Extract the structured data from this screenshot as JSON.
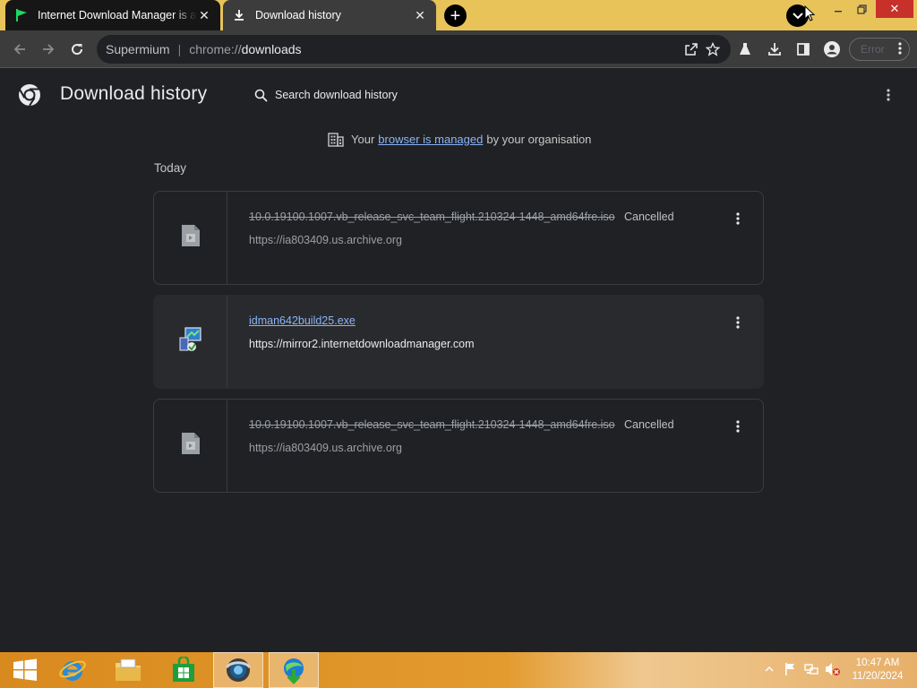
{
  "tabs": [
    {
      "title": "Internet Download Manager is a",
      "icon": "green-flag-icon"
    },
    {
      "title": "Download history",
      "icon": "download-icon"
    }
  ],
  "toolbar": {
    "site_name": "Supermium",
    "url_scheme": "chrome://",
    "url_host": "downloads",
    "error_label": "Error"
  },
  "page": {
    "title": "Download history",
    "search_placeholder": "Search download history"
  },
  "managed_notice": {
    "prefix": "Your",
    "link": "browser is managed",
    "suffix": "by your organisation"
  },
  "section_label": "Today",
  "downloads": [
    {
      "filename": "10.0.19100.1007.vb_release_svc_team_flight.210324-1448_amd64fre.iso",
      "status": "Cancelled",
      "url": "https://ia803409.us.archive.org"
    },
    {
      "filename": "idman642build25.exe",
      "status": "",
      "url": "https://mirror2.internetdownloadmanager.com"
    },
    {
      "filename": "10.0.19100.1007.vb_release_svc_team_flight.210324-1448_amd64fre.iso",
      "status": "Cancelled",
      "url": "https://ia803409.us.archive.org"
    }
  ],
  "taskbar": {
    "clock_time": "10:47 AM",
    "clock_date": "11/20/2024"
  },
  "colors": {
    "accent_link": "#8ab4f8",
    "tabstrip": "#e8c35a",
    "close_button": "#c7312a"
  }
}
